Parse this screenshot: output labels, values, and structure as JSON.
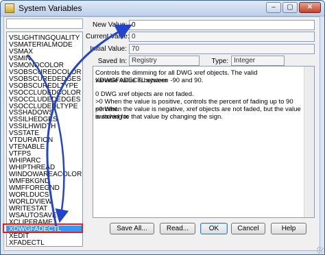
{
  "window": {
    "title": "System Variables",
    "min_glyph": "–",
    "max_glyph": "▢",
    "close_glyph": "✕"
  },
  "variables": [
    "VSLIGHTINGQUALITY",
    "VSMATERIALMODE",
    "VSMAX",
    "VSMIN",
    "VSMONOCOLOR",
    "VSOBSCUREDCOLOR",
    "VSOBSCUREDEDGES",
    "VSOBSCUREDLTYPE",
    "VSOCCLUDEDCOLOR",
    "VSOCCLUDEDEDGES",
    "VSOCCLUDEDLTYPE",
    "VSSHADOWS",
    "VSSILHEDGES",
    "VSSILHWIDTH",
    "VSSTATE",
    "VTDURATION",
    "VTENABLE",
    "VTFPS",
    "WHIPARC",
    "WHIPTHREAD",
    "WINDOWAREACOLOR",
    "WMFBKGND",
    "WMFFOREGND",
    "WORLDUCS",
    "WORLDVIEW",
    "WRITESTAT",
    "WSAUTOSAVE",
    "XCLIPFRAME",
    "XDWGFADECTL",
    "XEDIT",
    "XFADECTL"
  ],
  "selected_variable": "XDWGFADECTL",
  "fields": {
    "new_value_label": "New Value:",
    "new_value": "0",
    "current_value_label": "Current Value:",
    "current_value": "0",
    "initial_value_label": "Initial Value:",
    "initial_value": "70",
    "saved_in_label": "Saved In:",
    "saved_in": "Registry",
    "type_label": "Type:",
    "type": "Integer"
  },
  "description": {
    "line1": "Controls the dimming for all DWG xref objects. The valid XDWGFADECTL system",
    "line2": "variable value is between -90 and 90.",
    "opt0": "0     DWG xref objects are not faded.",
    "opt1": ">0   When the value is positive, controls the percent of fading up to 90 percent.",
    "opt2a": "<0   When the value is negative, xref objects are not faded, but the value is saved for",
    "opt2b": "switching to that value by changing the sign."
  },
  "buttons": {
    "save_all": "Save All...",
    "read": "Read...",
    "ok": "OK",
    "cancel": "Cancel",
    "help": "Help"
  },
  "annotation_color": "#2244cc",
  "highlight_color": "#e02020"
}
